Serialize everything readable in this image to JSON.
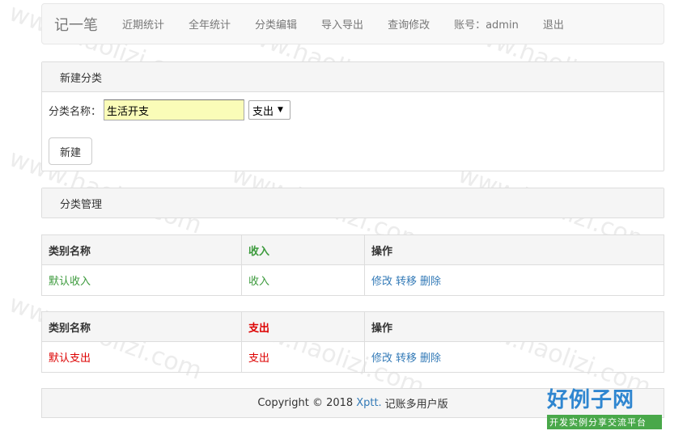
{
  "nav": {
    "brand": "记一笔",
    "items": [
      "近期统计",
      "全年统计",
      "分类编辑",
      "导入导出",
      "查询修改",
      "账号：admin",
      "退出"
    ]
  },
  "new_category": {
    "title": "新建分类",
    "label": "分类名称：",
    "input_value": "生活开支",
    "select_value": "支出",
    "button": "新建"
  },
  "manage": {
    "title": "分类管理"
  },
  "income_table": {
    "headers": [
      "类别名称",
      "收入",
      "操作"
    ],
    "row": {
      "name": "默认收入",
      "type": "收入",
      "actions": [
        "修改",
        "转移",
        "删除"
      ]
    }
  },
  "expense_table": {
    "headers": [
      "类别名称",
      "支出",
      "操作"
    ],
    "row": {
      "name": "默认支出",
      "type": "支出",
      "actions": [
        "修改",
        "转移",
        "删除"
      ]
    }
  },
  "footer": {
    "prefix": "Copyright © 2018",
    "link": "Xptt.",
    "suffix": "记账多用户版"
  },
  "watermark": {
    "text": "www.haolizi.com"
  },
  "logo": {
    "big": "好例子网",
    "sub": "开发实例分享交流平台"
  },
  "colors": {
    "income": "#3c9a3c",
    "expense": "#dd0000",
    "link": "#337ab7",
    "input_bg": "#fafcb8"
  }
}
